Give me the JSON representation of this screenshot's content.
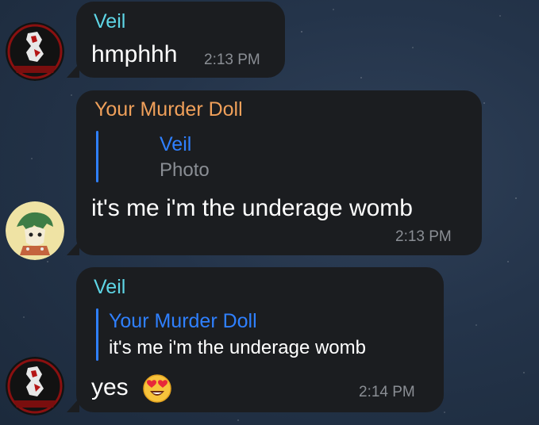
{
  "chat": {
    "messages": [
      {
        "sender": "Veil",
        "sender_color": "#5ed6e6",
        "text": "hmphhh",
        "time": "2:13 PM",
        "avatar": "veil-avatar"
      },
      {
        "sender": "Your Murder Doll",
        "sender_color": "#f0a05a",
        "reply": {
          "name": "Veil",
          "text": "Photo",
          "accent": "#2f80ff"
        },
        "text": "it's me i'm the underage womb",
        "time": "2:13 PM",
        "avatar": "murder-doll-avatar"
      },
      {
        "sender": "Veil",
        "sender_color": "#5ed6e6",
        "reply": {
          "name": "Your Murder Doll",
          "text": "it's me i'm the underage womb",
          "accent": "#2f80ff"
        },
        "text": "yes",
        "emoji": "heart-eyes-emoji",
        "time": "2:14 PM",
        "avatar": "veil-avatar"
      }
    ]
  }
}
